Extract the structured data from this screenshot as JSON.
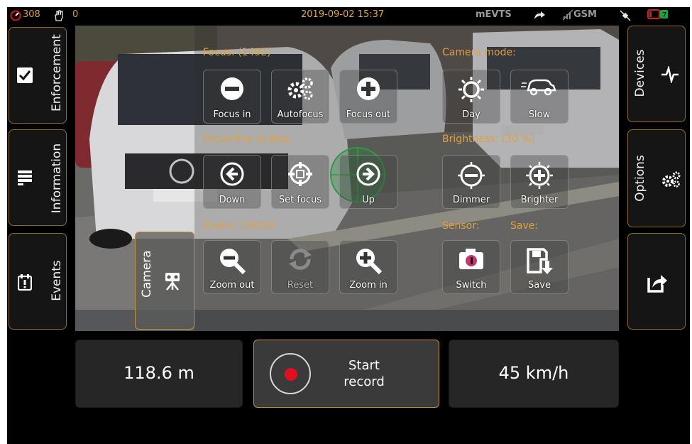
{
  "status_bar": {
    "counter_left": "308",
    "counter_right": "0",
    "datetime": "2019-09-02 15:37",
    "app_name": "mEVTS",
    "network": "GSM",
    "accent_color": "#d9a040",
    "battery_color": "#d02020",
    "icons": [
      "speedometer-icon",
      "hand-icon",
      "sync-icon",
      "no-signal-icon",
      "gps-icon",
      "battery-icon"
    ]
  },
  "left_menu": [
    {
      "label": "Enforcement",
      "icon": "checkbox-icon"
    },
    {
      "label": "Information",
      "icon": "list-icon"
    },
    {
      "label": "Events",
      "icon": "calendar-alert-icon"
    }
  ],
  "right_menu": [
    {
      "label": "Devices",
      "icon": "pulse-icon"
    },
    {
      "label": "Options",
      "icon": "gears-icon"
    },
    {
      "label": "",
      "icon": "share-icon"
    }
  ],
  "camera_panel": {
    "tab_label": "Camera",
    "focus": {
      "label": "Focus: (1492)",
      "buttons": [
        "Focus in",
        "Autofocus",
        "Focus out"
      ]
    },
    "fine_tuning": {
      "label": "Focus fine tuning:",
      "buttons": [
        "Down",
        "Set focus",
        "Up"
      ]
    },
    "zoom": {
      "label": "Zoom: (19/20)",
      "buttons": [
        "Zoom out",
        "Reset",
        "Zoom in"
      ]
    },
    "camera_mode": {
      "label": "Camera mode:",
      "buttons": [
        "Day",
        "Slow"
      ]
    },
    "brightness": {
      "label": "Brightness: (30 %)",
      "buttons": [
        "Dimmer",
        "Brighter"
      ]
    },
    "sensor": {
      "label": "Sensor:",
      "button": "Switch"
    },
    "save": {
      "label": "Save:",
      "button": "Save"
    }
  },
  "bottom_bar": {
    "distance": "118.6 m",
    "record_line1": "Start",
    "record_line2": "record",
    "speed": "45 km/h"
  }
}
